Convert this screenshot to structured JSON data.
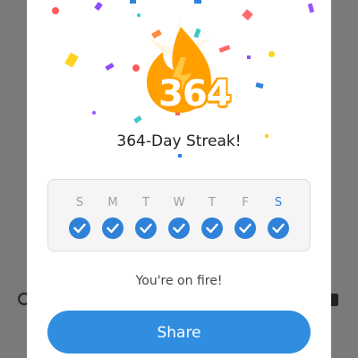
{
  "streak": {
    "count": "364",
    "title": "364-Day Streak!",
    "message": "You're on fire!"
  },
  "week": {
    "days": [
      {
        "label": "S",
        "done": true,
        "today": false
      },
      {
        "label": "M",
        "done": true,
        "today": false
      },
      {
        "label": "T",
        "done": true,
        "today": false
      },
      {
        "label": "W",
        "done": true,
        "today": false
      },
      {
        "label": "T",
        "done": true,
        "today": false
      },
      {
        "label": "F",
        "done": true,
        "today": false
      },
      {
        "label": "S",
        "done": true,
        "today": true
      }
    ]
  },
  "actions": {
    "share_label": "Share"
  },
  "colors": {
    "accent": "#2f82d8",
    "button": "#2f8ee0",
    "flame": "#ffa000",
    "flame_inner": "#ffc640"
  },
  "icons": {
    "flame": "flame-icon",
    "check": "check-icon"
  }
}
